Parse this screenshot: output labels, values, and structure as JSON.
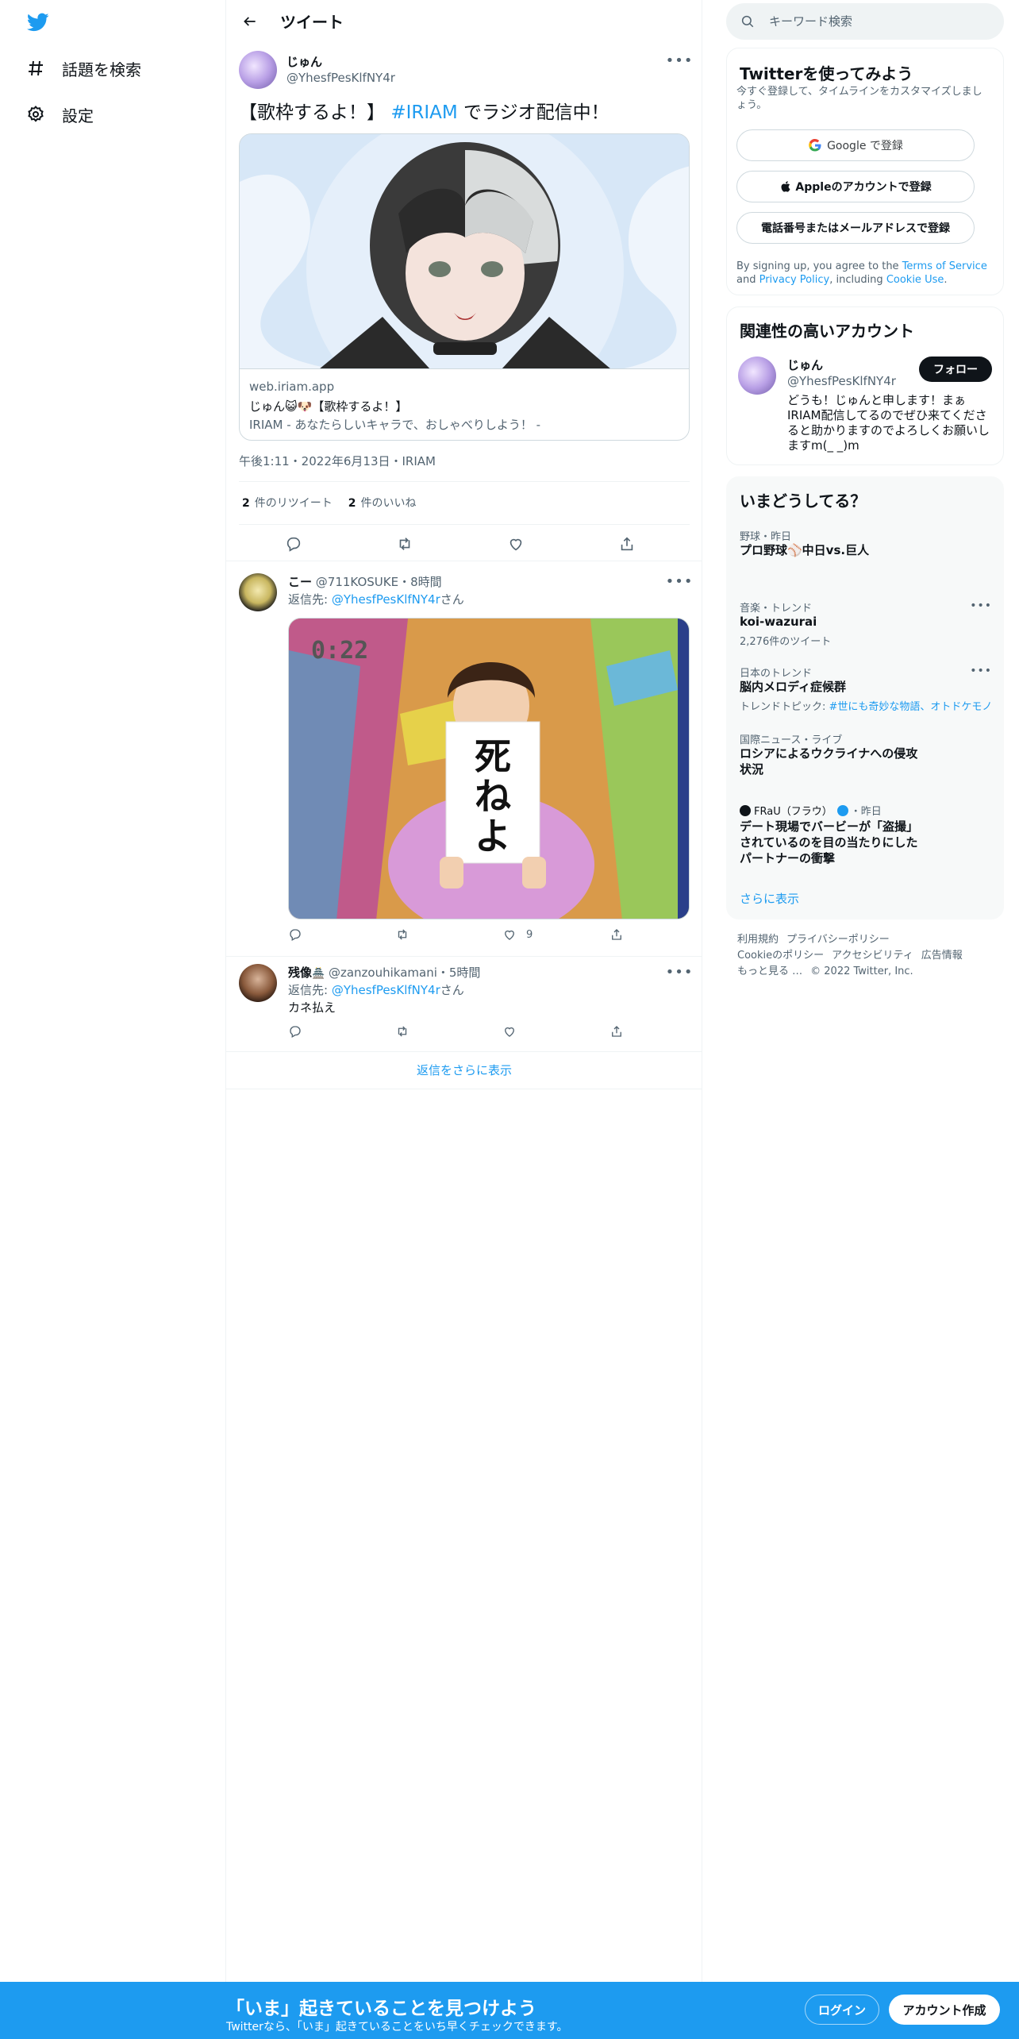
{
  "nav": {
    "items": [
      {
        "label": "話題を検索"
      },
      {
        "label": "設定"
      }
    ]
  },
  "header": {
    "title": "ツイート"
  },
  "tweet": {
    "author_name": "じゅん",
    "author_handle": "@YhesfPesKlfNY4r",
    "text_before": "【歌枠するよ！】 ",
    "hashtag": "#IRIAM",
    "text_after": " でラジオ配信中！",
    "card": {
      "domain": "web.iriam.app",
      "title": "じゅん😺🐶【歌枠するよ！】",
      "description": "IRIAM - あなたらしいキャラで、おしゃべりしよう！ -"
    },
    "meta": "午後1:11・2022年6月13日・IRIAM",
    "retweets_count": "2",
    "retweets_label": "件のリツイート",
    "likes_count": "2",
    "likes_label": "件のいいね"
  },
  "replies": [
    {
      "name": "こー",
      "handle": "@711KOSUKE",
      "time": "・8時間",
      "reply_prefix": "返信先: ",
      "reply_to": "@YhesfPesKlfNY4r",
      "reply_suffix": "さん",
      "media_timestamp": "0:22",
      "media_sign_line1": "死",
      "media_sign_line2": "ね",
      "media_sign_line3": "よ",
      "likes": "9"
    },
    {
      "name": "残像",
      "badge": "🏯",
      "handle": "@zanzouhikamani",
      "time": "・5時間",
      "reply_prefix": "返信先: ",
      "reply_to": "@YhesfPesKlfNY4r",
      "reply_suffix": "さん",
      "text": "カネ払え"
    }
  ],
  "show_more_replies": "返信をさらに表示",
  "search": {
    "placeholder": "キーワード検索"
  },
  "signup": {
    "title": "Twitterを使ってみよう",
    "subtitle": "今すぐ登録して、タイムラインをカスタマイズしましょう。",
    "google": "Google で登録",
    "apple": "Appleのアカウントで登録",
    "phone": "電話番号またはメールアドレスで登録",
    "terms_1": "By signing up, you agree to the ",
    "terms_link1": "Terms of Service",
    "terms_2": " and ",
    "terms_link2": "Privacy Policy",
    "terms_3": ", including ",
    "terms_link3": "Cookie Use",
    "terms_4": "."
  },
  "related": {
    "title": "関連性の高いアカウント",
    "name": "じゅん",
    "handle": "@YhesfPesKlfNY4r",
    "follow": "フォロー",
    "bio": "どうも！じゅんと申します！まぁIRIAM配信してるのでぜひ来てくださると助かりますのでよろしくお願いしますm(_ _)m"
  },
  "trends": {
    "title": "いまどうしてる？",
    "items": [
      {
        "category": "野球・昨日",
        "name": "プロ野球⚾中日vs.巨人"
      },
      {
        "category": "音楽・トレンド",
        "name": "koi-wazurai",
        "count": "2,276件のツイート"
      },
      {
        "category": "日本のトレンド",
        "name": "脳内メロディ症候群",
        "topic_label": "トレンドトピック: ",
        "topic": "#世にも奇妙な物語、オトドケモノ"
      },
      {
        "category": "国際ニュース・ライブ",
        "name": "ロシアによるウクライナへの侵攻状況"
      },
      {
        "source": "FRaU（フラウ）",
        "category": "・昨日",
        "name": "デート現場でバービーが「盗撮」されているのを目の当たりにしたパートナーの衝撃"
      }
    ],
    "show_more": "さらに表示"
  },
  "footer": {
    "line1": [
      "利用規約",
      "プライバシーポリシー"
    ],
    "line2": [
      "Cookieのポリシー",
      "アクセシビリティ",
      "広告情報"
    ],
    "line3": [
      "もっと見る …",
      "© 2022 Twitter, Inc."
    ]
  },
  "bottom_bar": {
    "title": "「いま」起きていることを見つけよう",
    "subtitle": "Twitterなら、「いま」起きていることをいち早くチェックできます。",
    "login": "ログイン",
    "signup": "アカウント作成"
  },
  "colors": {
    "accent": "#1d9bf0",
    "text": "#0f1419",
    "muted": "#536471",
    "border": "#eff3f4"
  }
}
